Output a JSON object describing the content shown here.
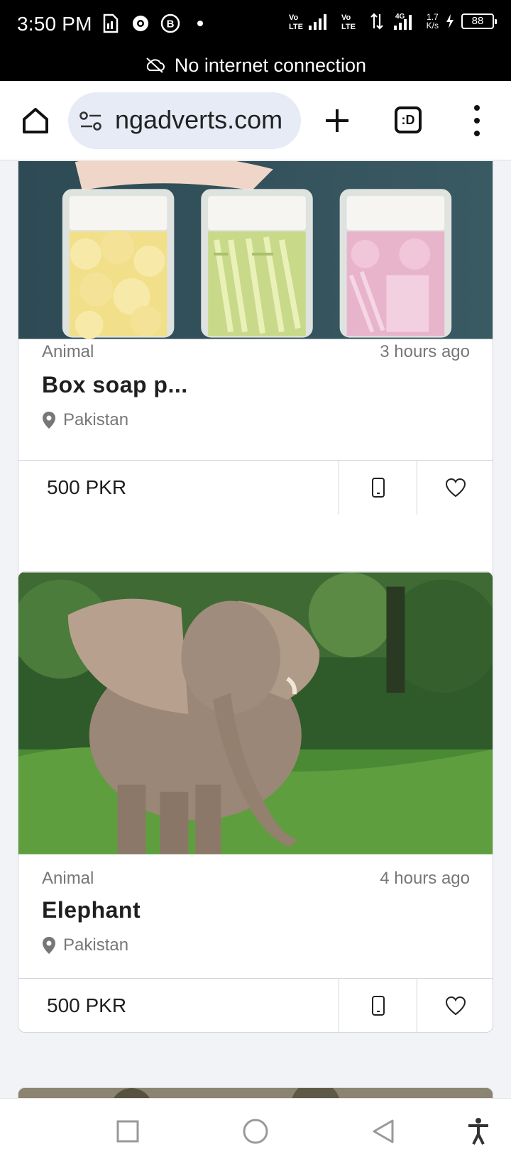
{
  "status_bar": {
    "time": "3:50 PM",
    "network_speed": "1.7",
    "network_unit": "K/s",
    "battery": "88"
  },
  "offline_banner": {
    "text": "No internet connection"
  },
  "browser": {
    "url": "ngadverts.com",
    "tabs_label": ":D"
  },
  "listings": [
    {
      "category": "Animal",
      "time": "3 hours ago",
      "title": "Box soap p...",
      "location": "Pakistan",
      "price": "500 PKR"
    },
    {
      "category": "Animal",
      "time": "4 hours ago",
      "title": "Elephant",
      "location": "Pakistan",
      "price": "500 PKR"
    }
  ],
  "colors": {
    "accent_url_bg": "#e6ebf6",
    "status_bg": "#000000",
    "page_bg": "#f2f3f7"
  }
}
